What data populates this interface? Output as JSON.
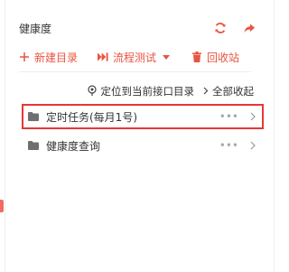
{
  "header": {
    "title": "健康度",
    "refresh_icon": "refresh-icon",
    "share_icon": "share-icon"
  },
  "toolbar": {
    "new_dir": "新建目录",
    "flow_test": "流程测试",
    "recycle_bin": "回收站"
  },
  "actions": {
    "locate": "定位到当前接口目录",
    "collapse_all": "全部收起"
  },
  "tree": {
    "items": [
      {
        "label": "定时任务(每月1号)",
        "selected": true,
        "more": "•••"
      },
      {
        "label": "健康度查询",
        "selected": false,
        "more": "•••"
      }
    ]
  },
  "colors": {
    "accent": "#e8543f",
    "selection_border": "#e53935",
    "folder": "#6f6f6f"
  }
}
